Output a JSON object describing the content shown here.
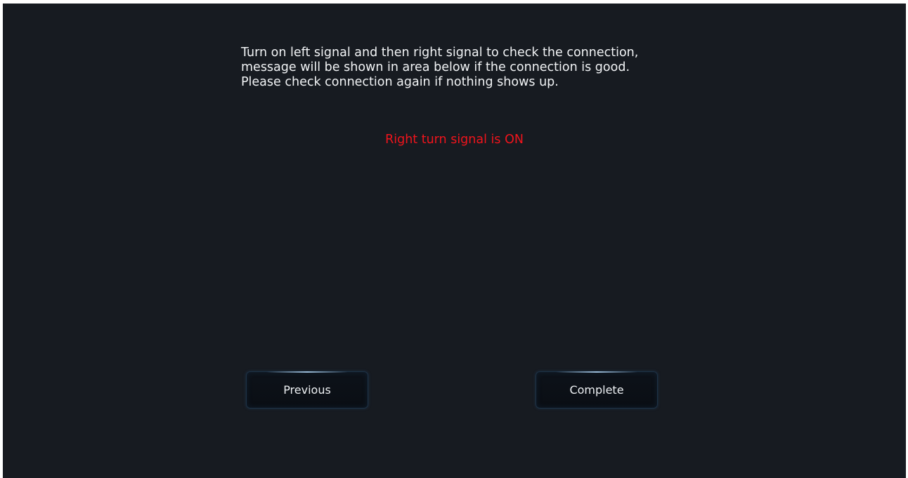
{
  "instructions": {
    "text": "Turn on left signal and then right signal to check the connection,\nmessage will be shown in area below if the connection is good.\nPlease check connection again if nothing shows up."
  },
  "status": {
    "message": "Right turn signal is ON",
    "color": "#f0141c"
  },
  "buttons": {
    "previous_label": "Previous",
    "complete_label": "Complete"
  },
  "colors": {
    "background": "#171b21",
    "text": "#f2f4f6",
    "button_border": "#1d3246"
  }
}
